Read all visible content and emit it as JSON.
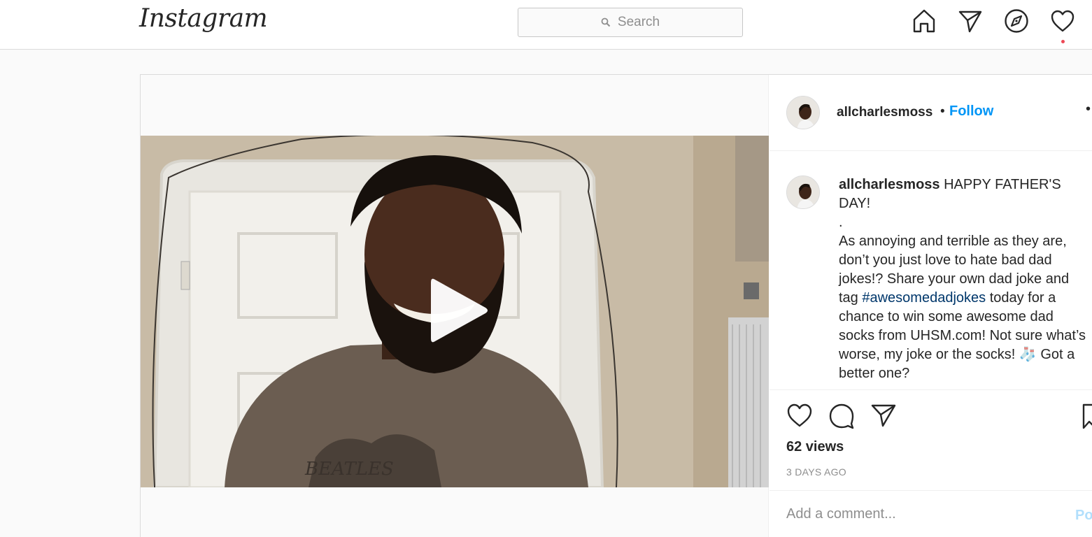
{
  "nav": {
    "logo": "Instagram",
    "search_placeholder": "Search",
    "icons": [
      "home-icon",
      "direct-icon",
      "explore-icon",
      "activity-icon"
    ],
    "activity_badge_color": "#ed4956"
  },
  "post": {
    "username": "allcharlesmoss",
    "follow_label": "Follow",
    "separator": "•",
    "more_label": "•",
    "caption": {
      "username": "allcharlesmoss",
      "line1": "HAPPY FATHER'S DAY!",
      "dot1": ".",
      "text_before_tag": "As annoying and terrible as they are, don’t you just love to hate bad dad jokes!? Share your own dad joke and tag ",
      "hashtag": "#awesomedadjokes",
      "text_after_tag": " today for a chance to win some awesome dad socks from UHSM.com! Not sure what’s worse, my joke or the socks! 🧦 Got a better one?",
      "dot2": "."
    },
    "views": "62 views",
    "time_ago": "3 DAYS AGO",
    "comment_placeholder": "Add a comment...",
    "post_label": "Post"
  },
  "colors": {
    "link_blue": "#0095f6",
    "hashtag": "#00376b",
    "border": "#dbdbdb"
  }
}
